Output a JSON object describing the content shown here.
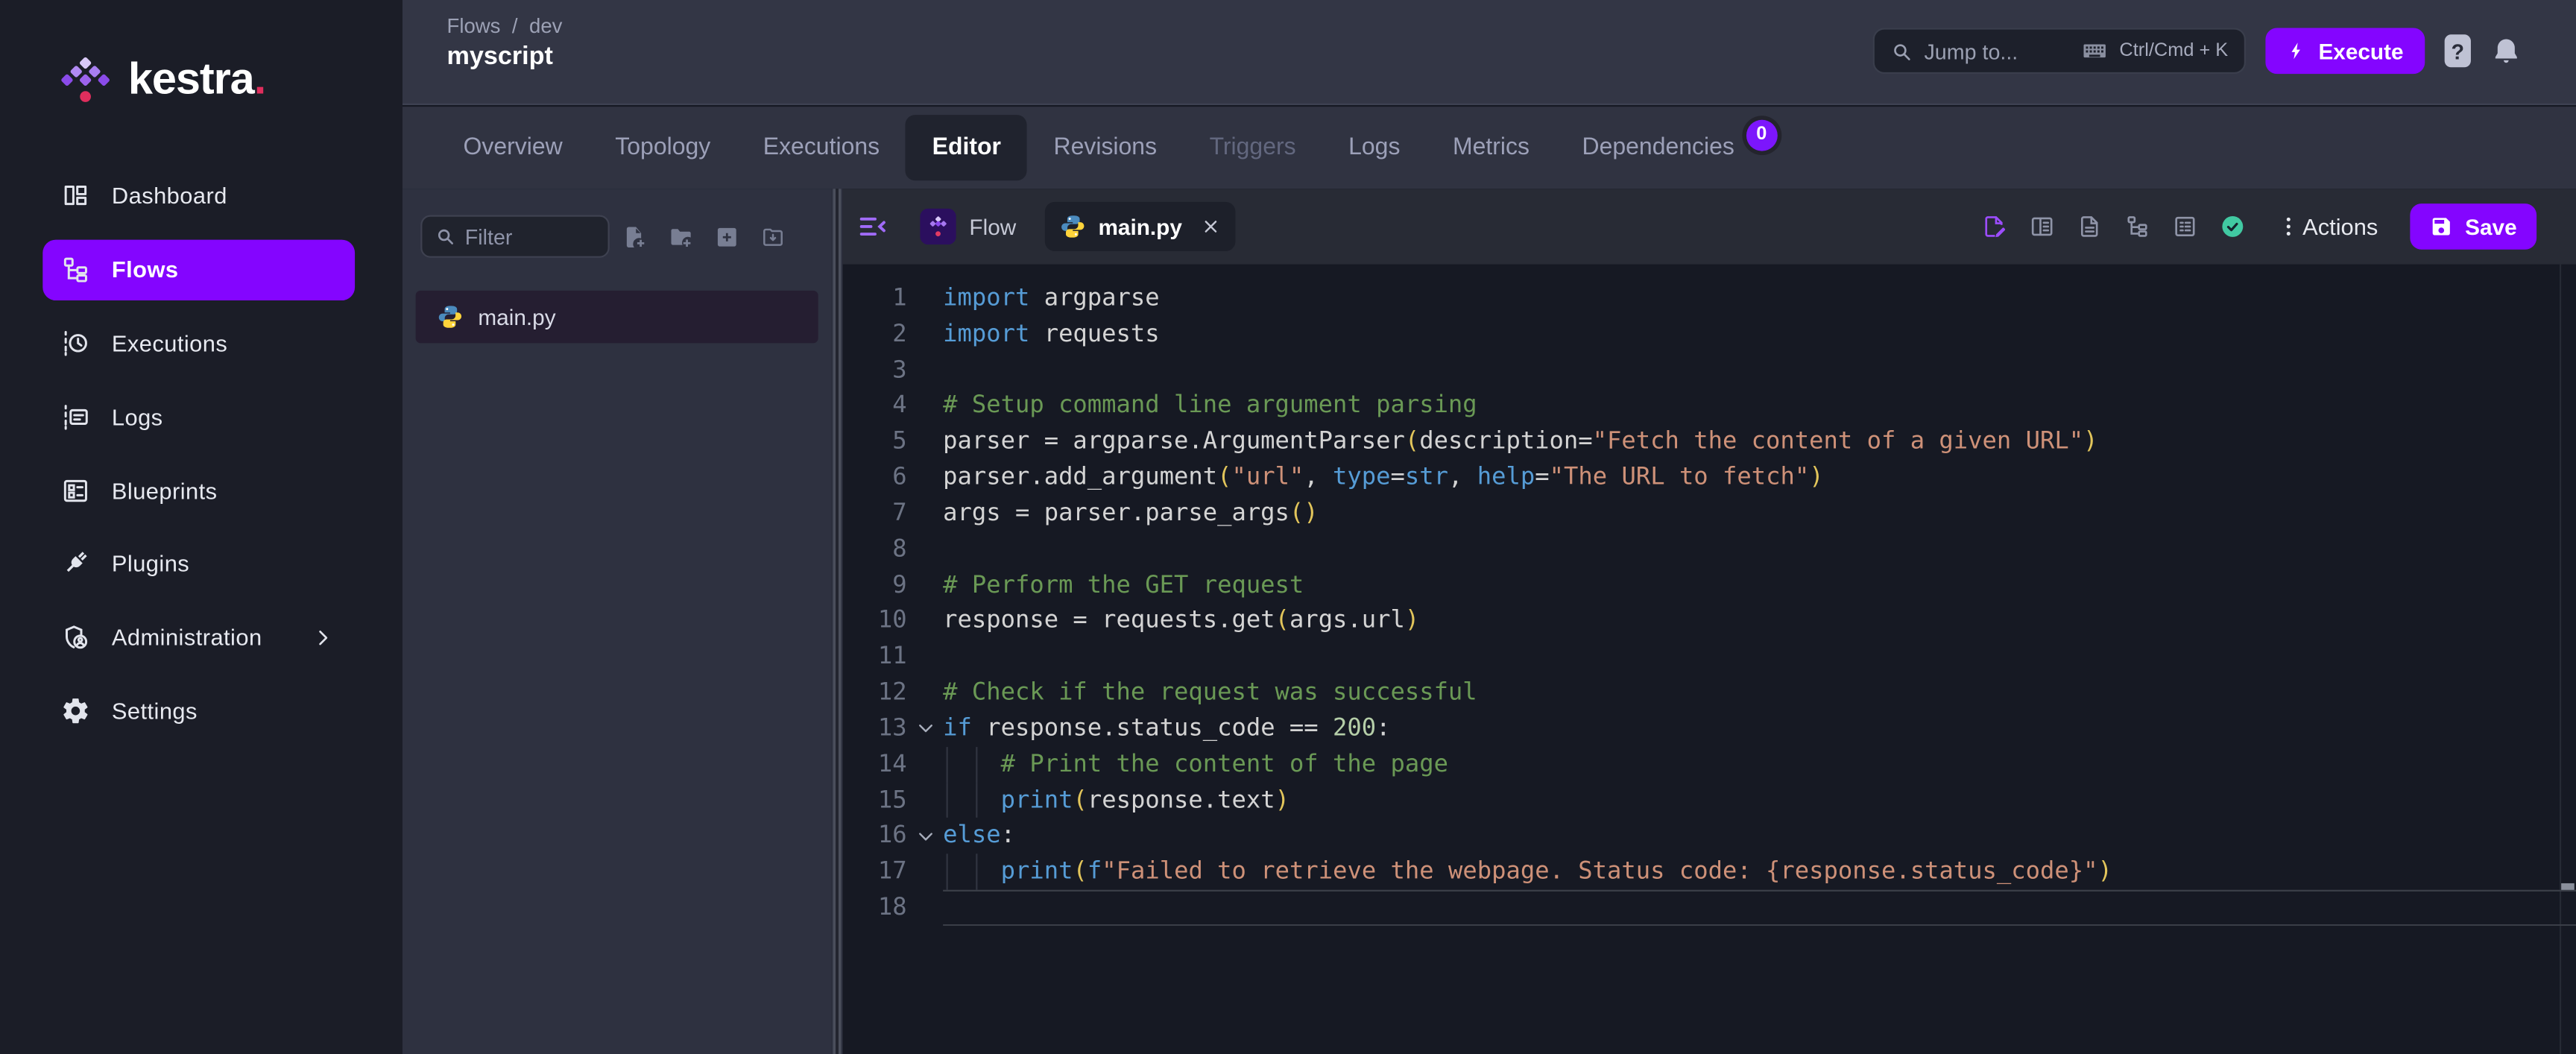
{
  "colors": {
    "accent": "#8405FF",
    "pink_dot": "#E02E5D",
    "badge_purple": "#7C16FC",
    "check_teal": "#41C9A2"
  },
  "sidebar": {
    "logo_text": "kestra",
    "logo_dot": ".",
    "items": [
      {
        "label": "Dashboard",
        "icon": "view-dashboard-icon",
        "active": false
      },
      {
        "label": "Flows",
        "icon": "flows-icon",
        "active": true
      },
      {
        "label": "Executions",
        "icon": "timeline-clock-icon",
        "active": false
      },
      {
        "label": "Logs",
        "icon": "timeline-text-icon",
        "active": false
      },
      {
        "label": "Blueprints",
        "icon": "blueprints-icon",
        "active": false
      },
      {
        "label": "Plugins",
        "icon": "power-plug-icon",
        "active": false
      },
      {
        "label": "Administration",
        "icon": "shield-account-icon",
        "active": false,
        "chevron": true
      },
      {
        "label": "Settings",
        "icon": "cog-icon",
        "active": false
      }
    ]
  },
  "header": {
    "breadcrumb": [
      "Flows",
      "dev"
    ],
    "breadcrumb_separator": "/",
    "title": "myscript",
    "search": {
      "placeholder": "Jump to...",
      "shortcut": "Ctrl/Cmd + K"
    },
    "execute_label": "Execute",
    "help_glyph": "?"
  },
  "flow_tabs": {
    "items": [
      {
        "label": "Overview"
      },
      {
        "label": "Topology"
      },
      {
        "label": "Executions"
      },
      {
        "label": "Editor",
        "active": true
      },
      {
        "label": "Revisions"
      },
      {
        "label": "Triggers",
        "disabled": true
      },
      {
        "label": "Logs"
      },
      {
        "label": "Metrics"
      },
      {
        "label": "Dependencies",
        "badge": "0"
      }
    ]
  },
  "file_panel": {
    "filter_placeholder": "Filter",
    "action_icons": [
      "file-plus-icon",
      "folder-plus-icon",
      "plus-box-icon",
      "folder-download-icon"
    ],
    "files": [
      {
        "name": "main.py",
        "icon": "python-icon",
        "selected": true
      }
    ]
  },
  "editor": {
    "tabs": [
      {
        "label": "Flow",
        "icon": "kestra-flow-icon",
        "active": false,
        "closable": false
      },
      {
        "label": "main.py",
        "icon": "python-icon",
        "active": true,
        "closable": true
      }
    ],
    "toolbar_icons": [
      "file-edit-icon",
      "layout-panel-icon",
      "file-document-icon",
      "tree-structure-icon",
      "list-box-icon",
      "check-circle-icon"
    ],
    "actions_label": "Actions",
    "save_label": "Save",
    "code": {
      "language": "python",
      "lines": [
        {
          "n": 1,
          "tokens": [
            [
              "k",
              "import"
            ],
            [
              "t",
              " argparse"
            ]
          ]
        },
        {
          "n": 2,
          "tokens": [
            [
              "k",
              "import"
            ],
            [
              "t",
              " requests"
            ]
          ]
        },
        {
          "n": 3,
          "tokens": []
        },
        {
          "n": 4,
          "tokens": [
            [
              "c",
              "# Setup command line argument parsing"
            ]
          ]
        },
        {
          "n": 5,
          "tokens": [
            [
              "t",
              "parser = argparse.ArgumentParser"
            ],
            [
              "p",
              "("
            ],
            [
              "t",
              "description="
            ],
            [
              "s",
              "\"Fetch the content of a given URL\""
            ],
            [
              "p",
              ")"
            ]
          ]
        },
        {
          "n": 6,
          "tokens": [
            [
              "t",
              "parser.add_argument"
            ],
            [
              "p",
              "("
            ],
            [
              "s",
              "\"url\""
            ],
            [
              "t",
              ", "
            ],
            [
              "k",
              "type"
            ],
            [
              "t",
              "="
            ],
            [
              "k",
              "str"
            ],
            [
              "t",
              ", "
            ],
            [
              "k",
              "help"
            ],
            [
              "t",
              "="
            ],
            [
              "s",
              "\"The URL to fetch\""
            ],
            [
              "p",
              ")"
            ]
          ]
        },
        {
          "n": 7,
          "tokens": [
            [
              "t",
              "args = parser.parse_args"
            ],
            [
              "p",
              "()"
            ]
          ]
        },
        {
          "n": 8,
          "tokens": []
        },
        {
          "n": 9,
          "tokens": [
            [
              "c",
              "# Perform the GET request"
            ]
          ]
        },
        {
          "n": 10,
          "tokens": [
            [
              "t",
              "response = requests.get"
            ],
            [
              "p",
              "("
            ],
            [
              "t",
              "args.url"
            ],
            [
              "p",
              ")"
            ]
          ]
        },
        {
          "n": 11,
          "tokens": []
        },
        {
          "n": 12,
          "tokens": [
            [
              "c",
              "# Check if the request was successful"
            ]
          ]
        },
        {
          "n": 13,
          "fold": true,
          "tokens": [
            [
              "k",
              "if"
            ],
            [
              "t",
              " response.status_code == "
            ],
            [
              "n2",
              "200"
            ],
            [
              "t",
              ":"
            ]
          ]
        },
        {
          "n": 14,
          "guide": true,
          "tokens": [
            [
              "t",
              "    "
            ],
            [
              "c",
              "# Print the content of the page"
            ]
          ]
        },
        {
          "n": 15,
          "guide": true,
          "tokens": [
            [
              "t",
              "    "
            ],
            [
              "k",
              "print"
            ],
            [
              "p",
              "("
            ],
            [
              "t",
              "response.text"
            ],
            [
              "p",
              ")"
            ]
          ]
        },
        {
          "n": 16,
          "fold": true,
          "tokens": [
            [
              "k",
              "else"
            ],
            [
              "t",
              ":"
            ]
          ]
        },
        {
          "n": 17,
          "guide": true,
          "tokens": [
            [
              "t",
              "    "
            ],
            [
              "k",
              "print"
            ],
            [
              "p",
              "("
            ],
            [
              "k",
              "f"
            ],
            [
              "s",
              "\"Failed to retrieve the webpage. Status code: {response.status_code}\""
            ],
            [
              "p",
              ")"
            ]
          ]
        },
        {
          "n": 18,
          "current": true,
          "tokens": []
        }
      ]
    }
  }
}
